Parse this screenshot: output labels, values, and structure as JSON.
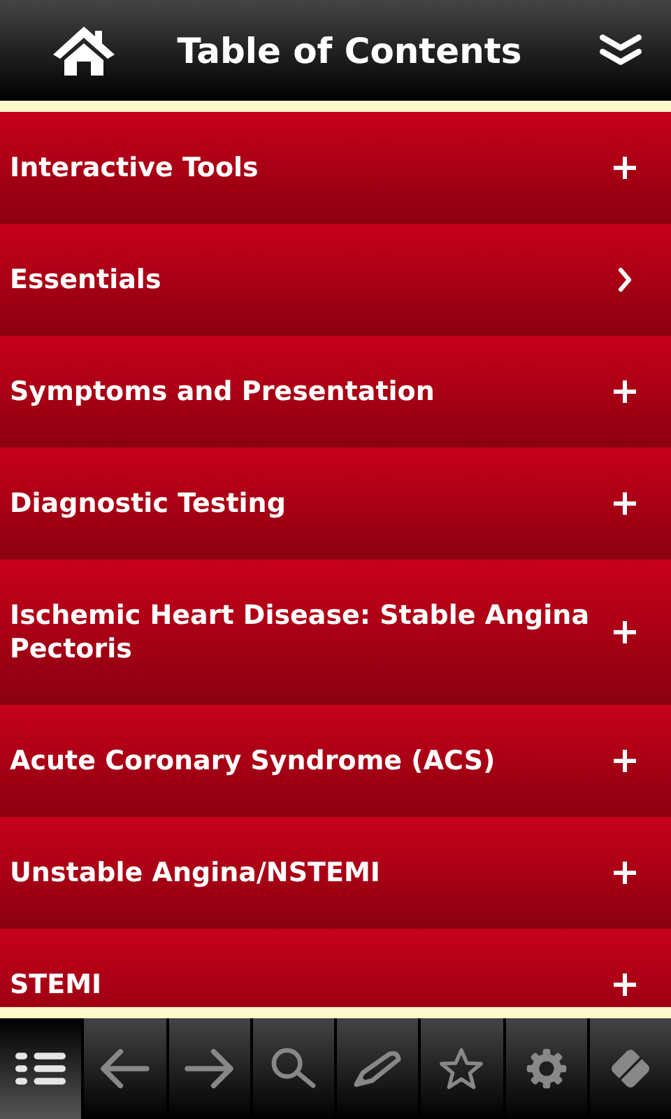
{
  "header": {
    "title": "Table of Contents"
  },
  "items": [
    {
      "label": "Interactive Tools",
      "kind": "expand"
    },
    {
      "label": "Essentials",
      "kind": "open"
    },
    {
      "label": "Symptoms and Presentation",
      "kind": "expand"
    },
    {
      "label": "Diagnostic Testing",
      "kind": "expand"
    },
    {
      "label": "Ischemic Heart Disease: Stable Angina Pectoris",
      "kind": "expand"
    },
    {
      "label": "Acute Coronary Syndrome (ACS)",
      "kind": "expand"
    },
    {
      "label": "Unstable Angina/NSTEMI",
      "kind": "expand"
    },
    {
      "label": "STEMI",
      "kind": "expand"
    }
  ],
  "toolbar": [
    {
      "selected": true
    },
    {
      "selected": false
    },
    {
      "selected": false
    },
    {
      "selected": false
    },
    {
      "selected": false
    },
    {
      "selected": false
    },
    {
      "selected": false
    },
    {
      "selected": false
    }
  ]
}
